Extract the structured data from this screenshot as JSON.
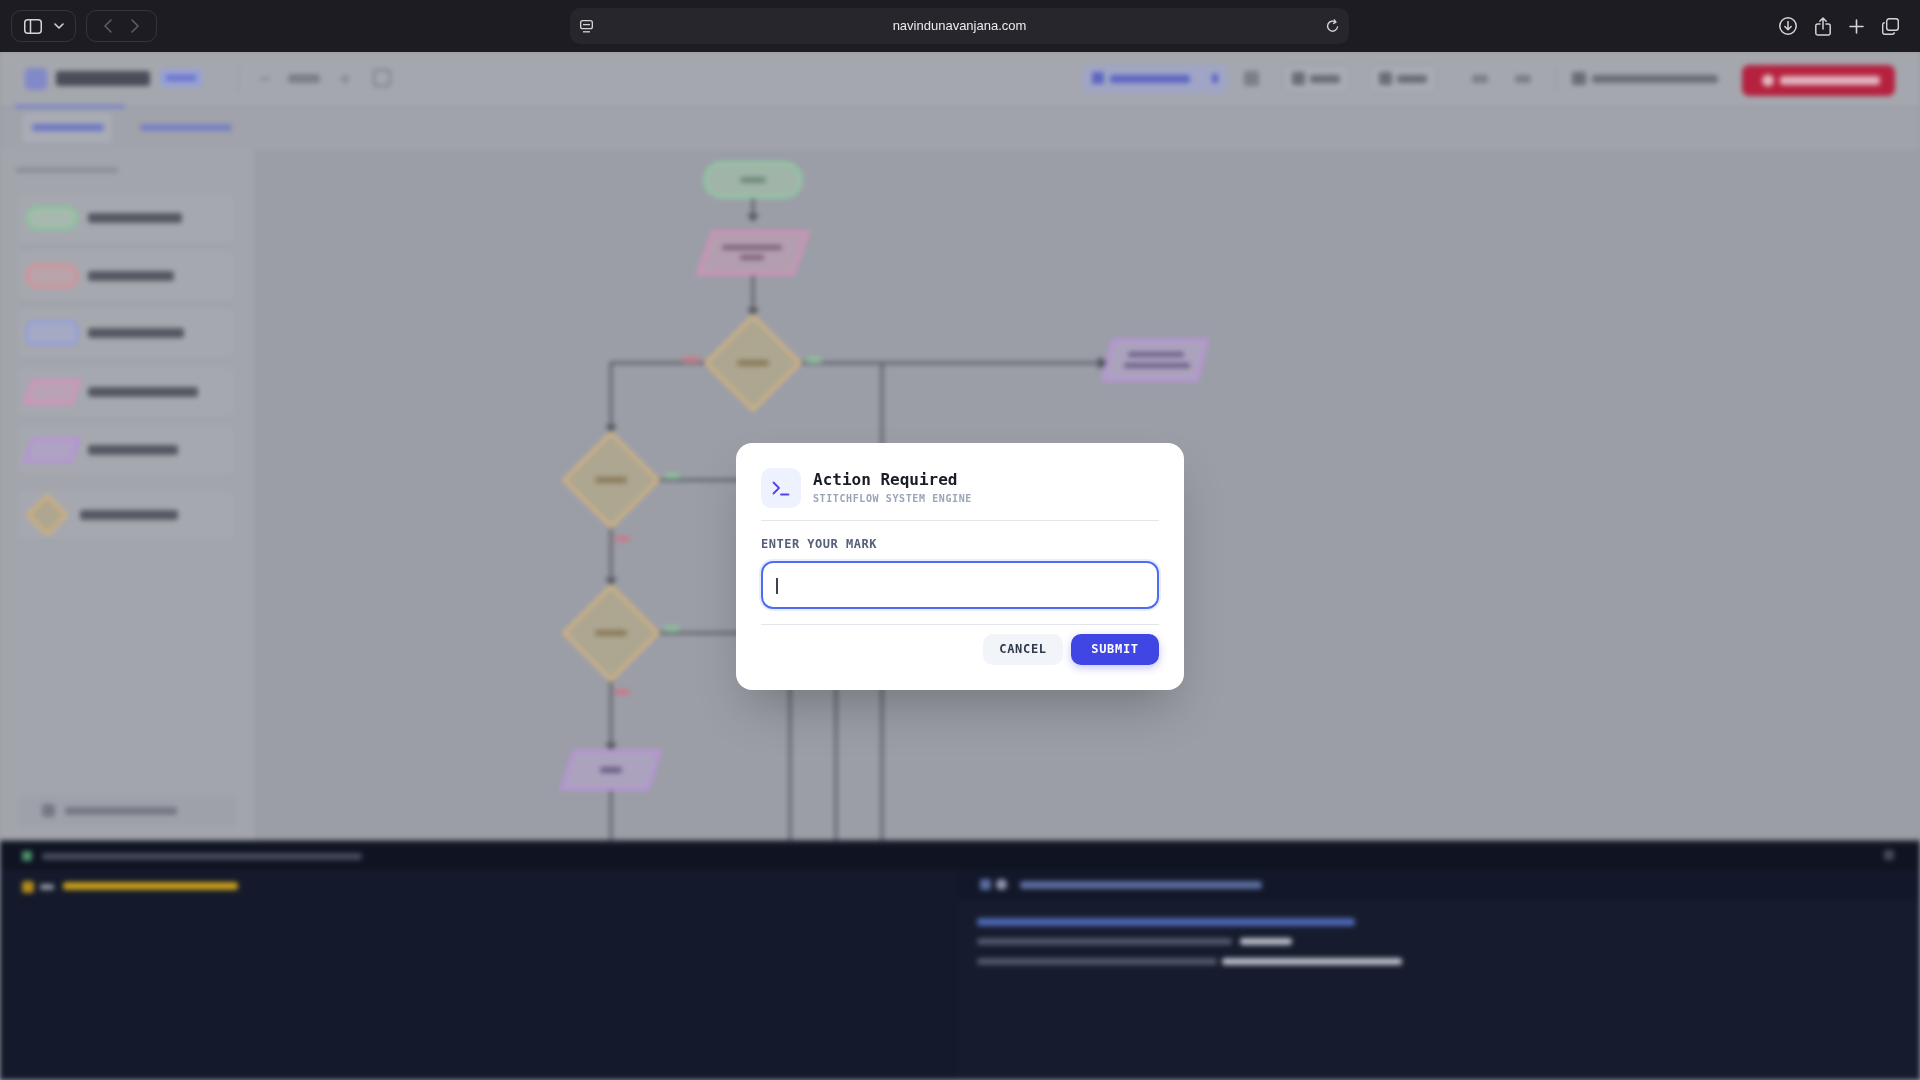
{
  "browser": {
    "url": "navindunavanjana.com",
    "nav_buttons": [
      {
        "kind": "back",
        "disabled": true
      },
      {
        "kind": "forward",
        "disabled": true
      }
    ]
  },
  "dialog": {
    "title": "Action Required",
    "subtitle": "STITCHFLOW SYSTEM ENGINE",
    "field": {
      "label": "ENTER YOUR MARK",
      "focused": true
    },
    "buttons": [
      {
        "label": "CANCEL",
        "kind": "secondary"
      },
      {
        "label": "SUBMIT",
        "kind": "primary"
      }
    ]
  }
}
